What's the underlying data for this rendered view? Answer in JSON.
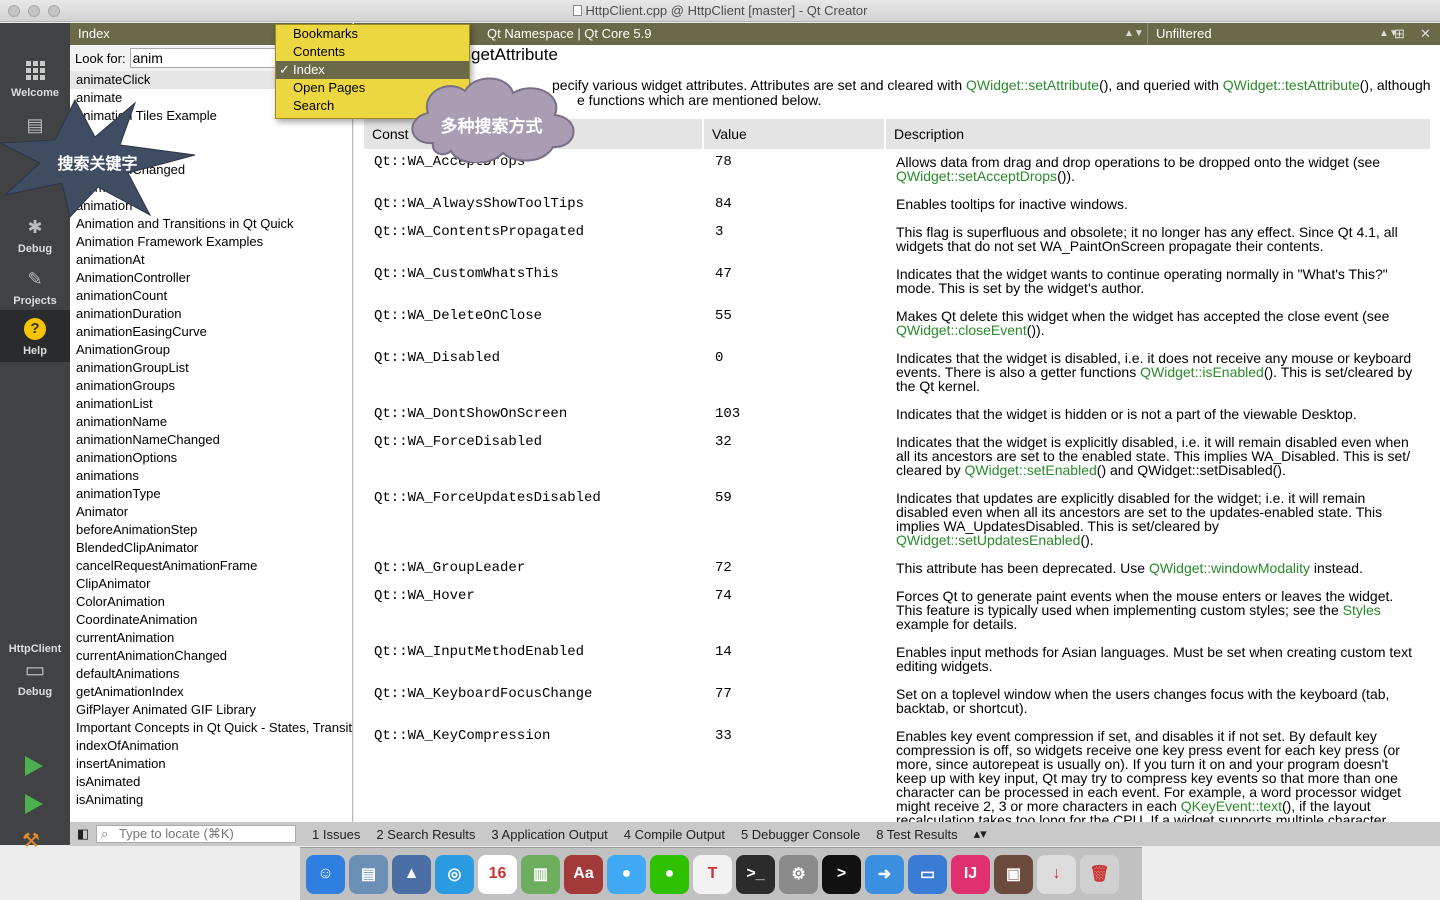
{
  "window": {
    "title": "HttpClient.cpp @ HttpClient [master] - Qt Creator"
  },
  "modes": [
    {
      "label": "Welcome"
    },
    {
      "label": "E"
    },
    {
      "label": "Debug"
    },
    {
      "label": "Projects"
    },
    {
      "label": "Help"
    }
  ],
  "target": {
    "project": "HttpClient",
    "config": "Debug"
  },
  "sidebar": {
    "view": "Index",
    "look_for_label": "Look for:",
    "look_for_value": "anim",
    "items": [
      "animateClick",
      "animate",
      "animation Tiles Example",
      "",
      "",
      "animationChanged",
      "Animation",
      "animation",
      "Animation and Transitions in Qt Quick",
      "Animation Framework Examples",
      "animationAt",
      "AnimationController",
      "animationCount",
      "animationDuration",
      "animationEasingCurve",
      "AnimationGroup",
      "animationGroupList",
      "animationGroups",
      "animationList",
      "animationName",
      "animationNameChanged",
      "animationOptions",
      "animations",
      "animationType",
      "Animator",
      "beforeAnimationStep",
      "BlendedClipAnimator",
      "cancelRequestAnimationFrame",
      "ClipAnimator",
      "ColorAnimation",
      "CoordinateAnimation",
      "currentAnimation",
      "currentAnimationChanged",
      "defaultAnimations",
      "getAnimationIndex",
      "GifPlayer Animated GIF Library",
      "Important Concepts in Qt Quick - States, Transitions and Animations",
      "indexOfAnimation",
      "insertAnimation",
      "isAnimated",
      "isAnimating"
    ]
  },
  "dropdown": {
    "items": [
      "Bookmarks",
      "Contents",
      "Index",
      "Open Pages",
      "Search"
    ],
    "selected": "Index"
  },
  "content": {
    "doc": "Qt Namespace | Qt Core 5.9",
    "filter": "Unfiltered",
    "page_title": "getAttribute",
    "intro_a": "pecify various widget attributes. Attributes are set and cleared with ",
    "intro_link1": "QWidget::setAttribute",
    "intro_b": "(), and queried with ",
    "intro_link2": "QWidget::testAttribute",
    "intro_c": "(), although",
    "intro_line2": "e functions which are mentioned below.",
    "headers": [
      "Const",
      "Value",
      "Description"
    ],
    "rows": [
      {
        "name": "Qt::WA_AcceptDrops",
        "value": "78",
        "desc": "Allows data from drag and drop operations to be dropped onto the widget (see ",
        "link": "QWidget::setAcceptDrops",
        "tail": "())."
      },
      {
        "name": "Qt::WA_AlwaysShowToolTips",
        "value": "84",
        "desc": "Enables tooltips for inactive windows.",
        "link": "",
        "tail": ""
      },
      {
        "name": "Qt::WA_ContentsPropagated",
        "value": "3",
        "desc": "This flag is superfluous and obsolete; it no longer has any effect. Since Qt 4.1, all widgets that do not set WA_PaintOnScreen propagate their contents.",
        "link": "",
        "tail": ""
      },
      {
        "name": "Qt::WA_CustomWhatsThis",
        "value": "47",
        "desc": "Indicates that the widget wants to continue operating normally in \"What's This?\" mode. This is set by the widget's author.",
        "link": "",
        "tail": ""
      },
      {
        "name": "Qt::WA_DeleteOnClose",
        "value": "55",
        "desc": "Makes Qt delete this widget when the widget has accepted the close event (see ",
        "link": "QWidget::closeEvent",
        "tail": "())."
      },
      {
        "name": "Qt::WA_Disabled",
        "value": "0",
        "desc": "Indicates that the widget is disabled, i.e. it does not receive any mouse or keyboard events. There is also a getter functions ",
        "link": "QWidget::isEnabled",
        "tail": "(). This is set/cleared by the Qt kernel."
      },
      {
        "name": "Qt::WA_DontShowOnScreen",
        "value": "103",
        "desc": "Indicates that the widget is hidden or is not a part of the viewable Desktop.",
        "link": "",
        "tail": ""
      },
      {
        "name": "Qt::WA_ForceDisabled",
        "value": "32",
        "desc": "Indicates that the widget is explicitly disabled, i.e. it will remain disabled even when all its ancestors are set to the enabled state. This implies WA_Disabled. This is set/ cleared by ",
        "link": "QWidget::setEnabled",
        "tail": "() and QWidget::setDisabled()."
      },
      {
        "name": "Qt::WA_ForceUpdatesDisabled",
        "value": "59",
        "desc": "Indicates that updates are explicitly disabled for the widget; i.e. it will remain disabled even when all its ancestors are set to the updates-enabled state. This implies WA_UpdatesDisabled. This is set/cleared by ",
        "link": "QWidget::setUpdatesEnabled",
        "tail": "()."
      },
      {
        "name": "Qt::WA_GroupLeader",
        "value": "72",
        "desc": "This attribute has been deprecated. Use ",
        "link": "QWidget::windowModality",
        "tail": " instead."
      },
      {
        "name": "Qt::WA_Hover",
        "value": "74",
        "desc": "Forces Qt to generate paint events when the mouse enters or leaves the widget. This feature is typically used when implementing custom styles; see the ",
        "link": "Styles",
        "tail": " example for details."
      },
      {
        "name": "Qt::WA_InputMethodEnabled",
        "value": "14",
        "desc": "Enables input methods for Asian languages. Must be set when creating custom text editing widgets.",
        "link": "",
        "tail": ""
      },
      {
        "name": "Qt::WA_KeyboardFocusChange",
        "value": "77",
        "desc": "Set on a toplevel window when the users changes focus with the keyboard (tab, backtab, or shortcut).",
        "link": "",
        "tail": ""
      },
      {
        "name": "Qt::WA_KeyCompression",
        "value": "33",
        "desc": "Enables key event compression if set, and disables it if not set. By default key compression is off, so widgets receive one key press event for each key press (or more, since autorepeat is usually on). If you turn it on and your program doesn't keep up with key input, Qt may try to compress key events so that more than one character can be processed in each event. For example, a word processor widget might receive 2, 3 or more characters in each ",
        "link": "QKeyEvent::text",
        "tail": "(), if the layout recalculation takes too long for the CPU. If a widget supports multiple character"
      }
    ]
  },
  "bottombar": {
    "locate_placeholder": "Type to locate (⌘K)",
    "tabs": [
      "1  Issues",
      "2  Search Results",
      "3  Application Output",
      "4  Compile Output",
      "5  Debugger Console",
      "8  Test Results"
    ]
  },
  "annotations": {
    "cloud": "多种搜索方式",
    "star": "搜索关键字"
  },
  "dock": [
    {
      "name": "finder",
      "color": "#2f7fe0",
      "glyph": "☺"
    },
    {
      "name": "preview",
      "color": "#6b8fb5",
      "glyph": "▤"
    },
    {
      "name": "launchpad",
      "color": "#4a6fa5",
      "glyph": "▲"
    },
    {
      "name": "safari",
      "color": "#2a9be0",
      "glyph": "◎"
    },
    {
      "name": "calendar",
      "color": "#ffffff",
      "glyph": "16"
    },
    {
      "name": "maps",
      "color": "#6cae5e",
      "glyph": "▥"
    },
    {
      "name": "dictionary",
      "color": "#a33a3a",
      "glyph": "Aa"
    },
    {
      "name": "messages",
      "color": "#3fa9f5",
      "glyph": "●"
    },
    {
      "name": "wechat",
      "color": "#2dc100",
      "glyph": "●"
    },
    {
      "name": "typora",
      "color": "#f2f2f2",
      "glyph": "T"
    },
    {
      "name": "terminal-like",
      "color": "#2b2b2b",
      "glyph": ">_"
    },
    {
      "name": "utility",
      "color": "#8a8a8a",
      "glyph": "⚙"
    },
    {
      "name": "terminal",
      "color": "#111111",
      "glyph": ">"
    },
    {
      "name": "nav",
      "color": "#3b8fe0",
      "glyph": "➜"
    },
    {
      "name": "keynote",
      "color": "#3a7bd5",
      "glyph": "▭"
    },
    {
      "name": "intellij",
      "color": "#e0306f",
      "glyph": "IJ"
    },
    {
      "name": "photo",
      "color": "#6b4b3b",
      "glyph": "▣"
    },
    {
      "name": "downloads",
      "color": "#dcdcdc",
      "glyph": "↓"
    },
    {
      "name": "trash",
      "color": "#d0d0d0",
      "glyph": "🗑"
    }
  ]
}
